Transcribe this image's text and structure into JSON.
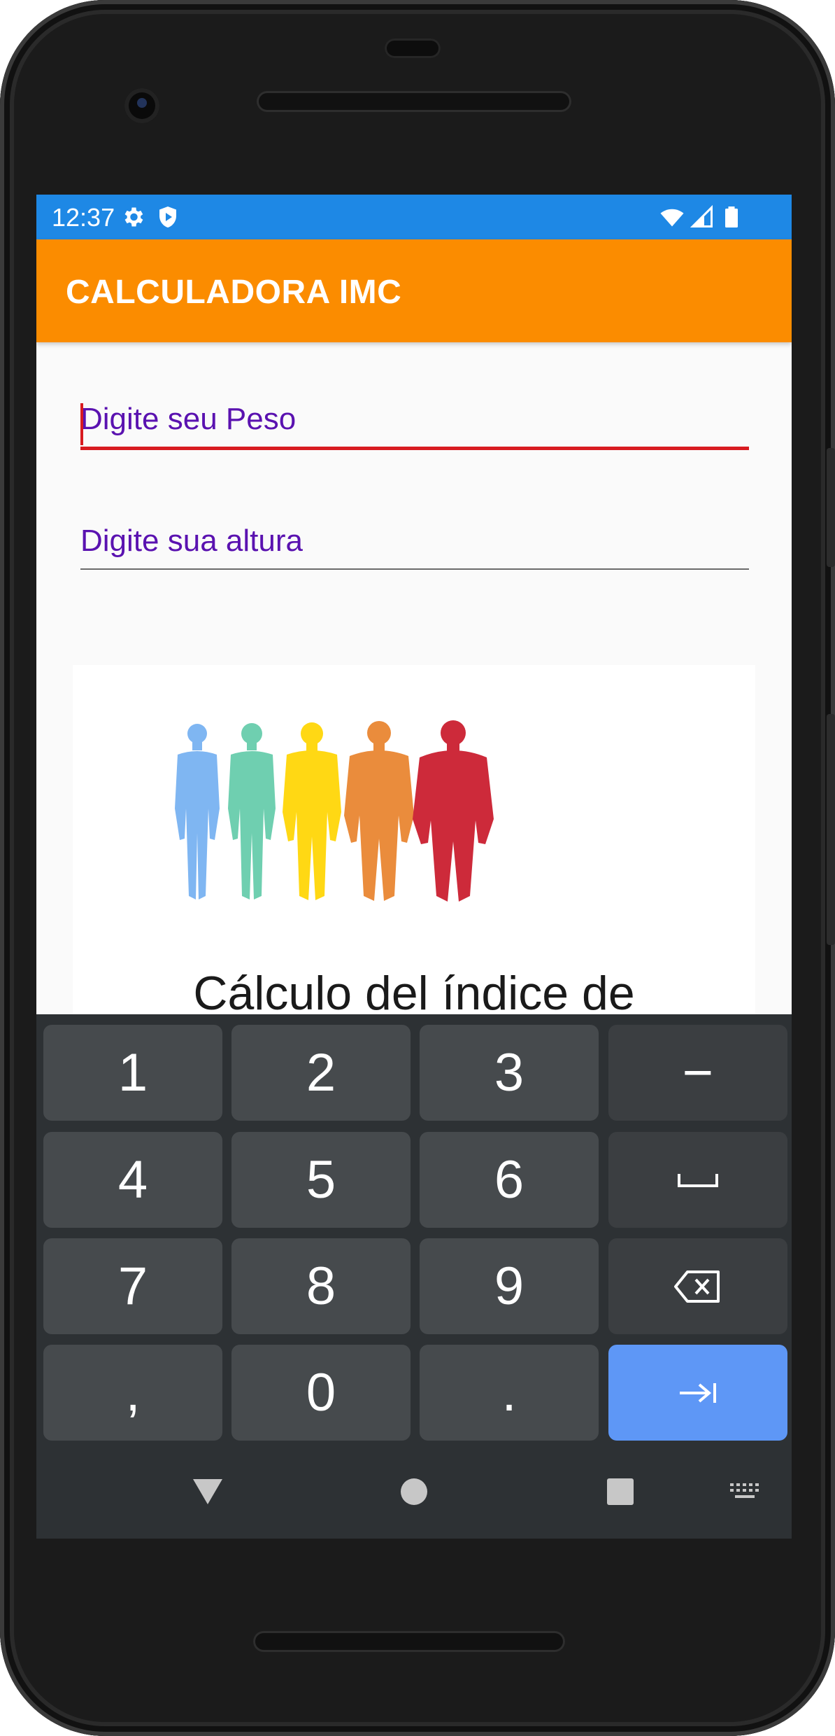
{
  "status_bar": {
    "time": "12:37",
    "icons": [
      "gear-icon",
      "shield-icon",
      "wifi-icon",
      "signal-icon",
      "battery-icon"
    ],
    "background_color": "#1e88e5"
  },
  "app_bar": {
    "title": "CALCULADORA IMC",
    "background_color": "#fb8c00"
  },
  "form": {
    "peso_placeholder": "Digite seu Peso",
    "peso_value": "",
    "altura_placeholder": "Digite sua altura",
    "altura_value": "",
    "focused_field": "peso",
    "accent_color": "#d81b20",
    "hint_color": "#5a12b0"
  },
  "banner": {
    "text": "Cálculo del índice de",
    "figure_colors": [
      "#7fb6f2",
      "#6fcfb0",
      "#ffd814",
      "#ea8c3c",
      "#cd2a3a"
    ]
  },
  "keyboard": {
    "rows": [
      [
        "1",
        "2",
        "3",
        "-"
      ],
      [
        "4",
        "5",
        "6",
        "space"
      ],
      [
        "7",
        "8",
        "9",
        "backspace"
      ],
      [
        ",",
        "0",
        ".",
        "next"
      ]
    ],
    "key_labels": {
      "k1": "1",
      "k2": "2",
      "k3": "3",
      "minus": "−",
      "k4": "4",
      "k5": "5",
      "k6": "6",
      "k7": "7",
      "k8": "8",
      "k9": "9",
      "comma": ",",
      "k0": "0",
      "period": "."
    },
    "action_color": "#5e97f6"
  },
  "nav_bar": {
    "icons": [
      "back-icon",
      "home-icon",
      "recents-icon",
      "keyboard-switch-icon"
    ]
  }
}
